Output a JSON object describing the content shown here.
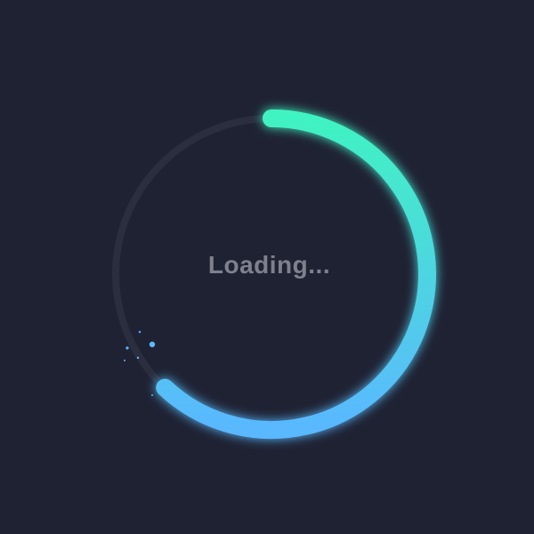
{
  "loader": {
    "label": "Loading...",
    "progress": 0.62,
    "colors": {
      "background": "#1f2233",
      "track": "#2b2e3f",
      "gradient_start": "#3ff5c0",
      "gradient_end": "#5ab8ff",
      "label": "#7e808d"
    }
  }
}
